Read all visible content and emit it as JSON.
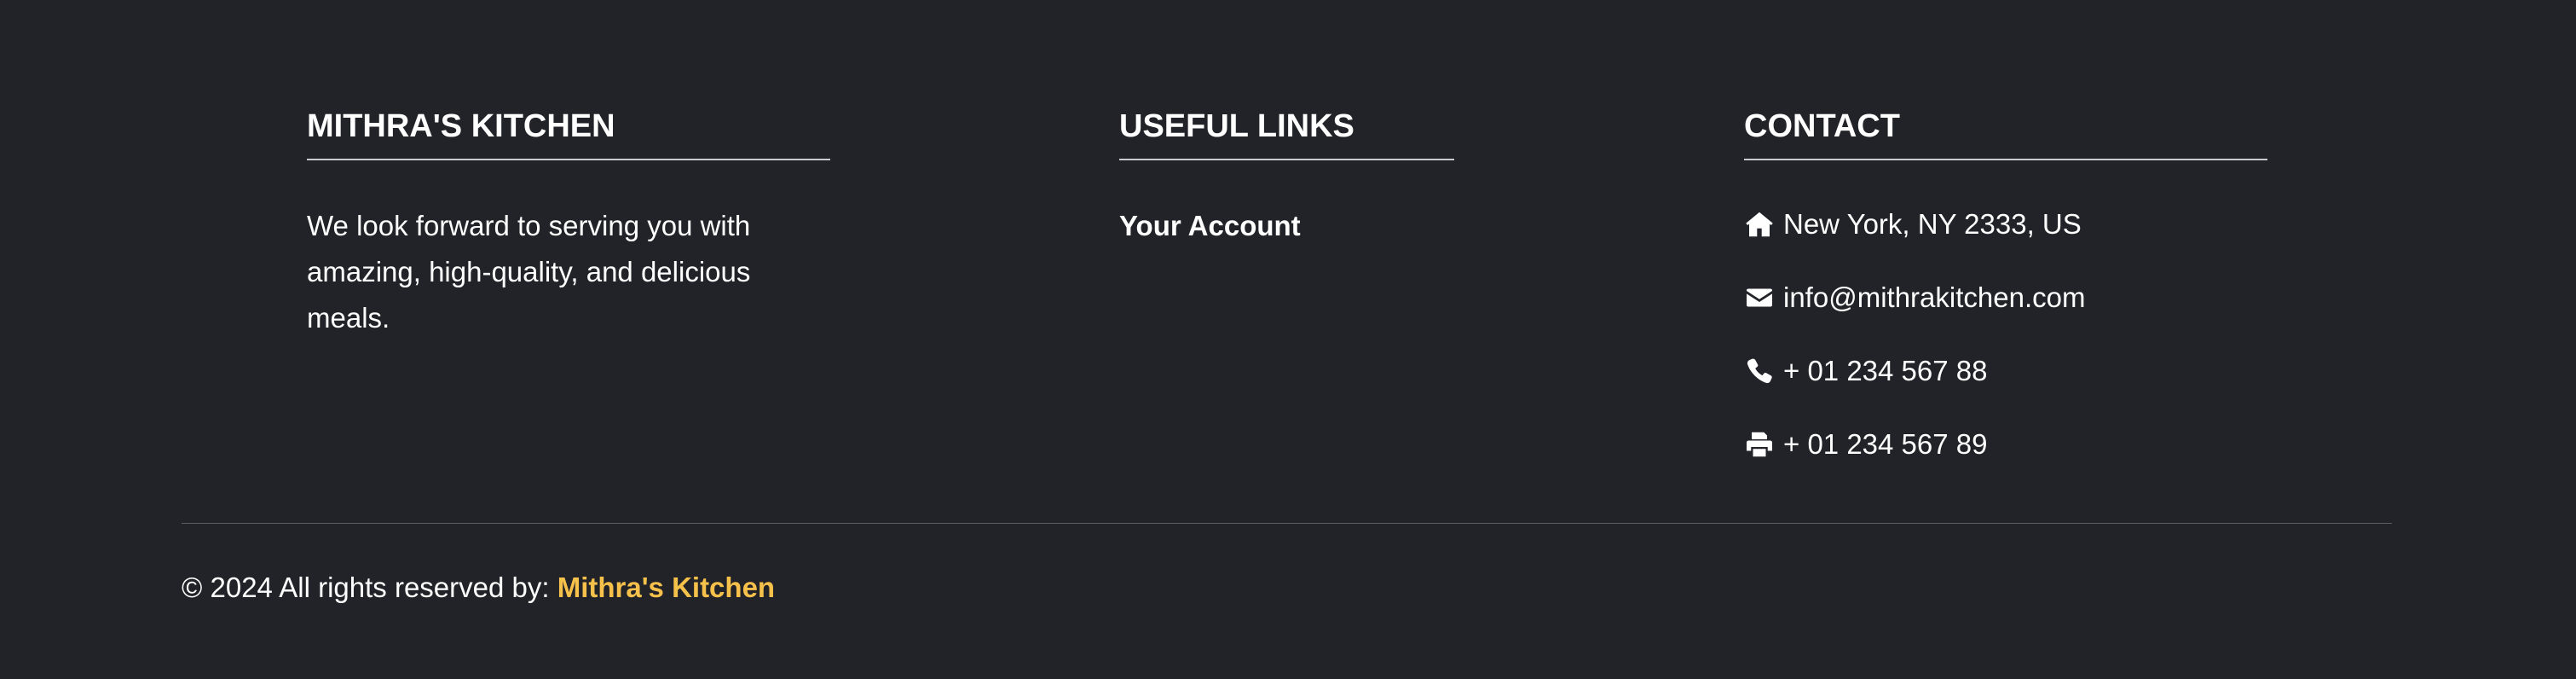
{
  "footer": {
    "about": {
      "heading": "MITHRA'S KITCHEN",
      "text": "We look forward to serving you with amazing, high-quality, and delicious meals."
    },
    "links": {
      "heading": "USEFUL LINKS",
      "items": [
        {
          "label": "Your Account"
        }
      ]
    },
    "contact": {
      "heading": "CONTACT",
      "address": {
        "icon": "home-icon",
        "text": "New York, NY 2333, US"
      },
      "email": {
        "icon": "envelope-icon",
        "text": "info@mithrakitchen.com"
      },
      "phone": {
        "icon": "phone-icon",
        "text": "+ 01 234 567 88"
      },
      "fax": {
        "icon": "printer-icon",
        "text": "+ 01 234 567 89"
      }
    },
    "copyright": {
      "prefix": "© 2024 All rights reserved by: ",
      "brand": "Mithra's Kitchen"
    }
  },
  "colors": {
    "background": "#212328",
    "text": "#ffffff",
    "accent": "#f6c14b",
    "divider": "#5b5d62"
  }
}
